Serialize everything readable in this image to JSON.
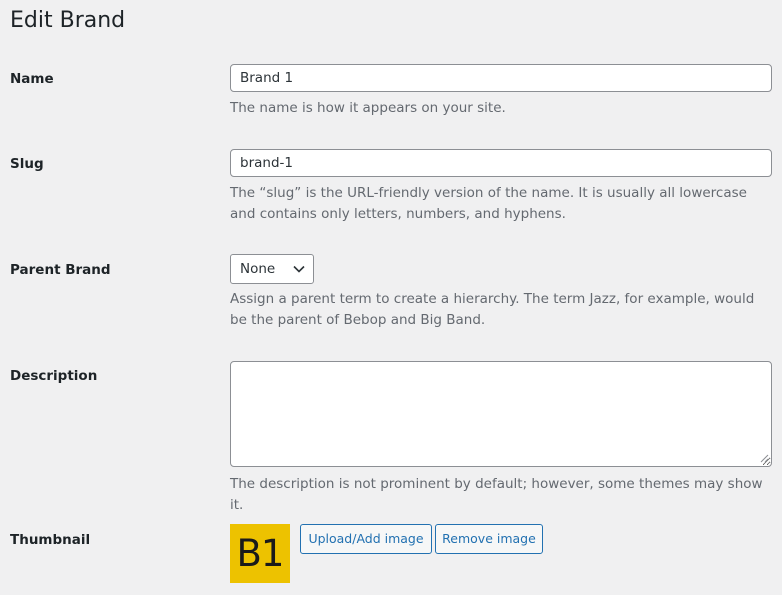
{
  "page": {
    "title": "Edit Brand"
  },
  "form": {
    "name": {
      "label": "Name",
      "value": "Brand 1",
      "help": "The name is how it appears on your site."
    },
    "slug": {
      "label": "Slug",
      "value": "brand-1",
      "help": "The “slug” is the URL-friendly version of the name. It is usually all lowercase and contains only letters, numbers, and hyphens."
    },
    "parent": {
      "label": "Parent Brand",
      "selected": "None",
      "help": "Assign a parent term to create a hierarchy. The term Jazz, for example, would be the parent of Bebop and Big Band."
    },
    "description": {
      "label": "Description",
      "value": "",
      "help": "The description is not prominent by default; however, some themes may show it."
    },
    "thumbnail": {
      "label": "Thumbnail",
      "image_text": "B1",
      "image_color": "#edc200",
      "upload_label": "Upload/Add image",
      "remove_label": "Remove image"
    }
  },
  "colors": {
    "button_accent": "#2271b1",
    "background": "#f0f0f1"
  },
  "icons": {
    "select": "chevron-down-icon",
    "textarea": "resize-grip-icon"
  }
}
